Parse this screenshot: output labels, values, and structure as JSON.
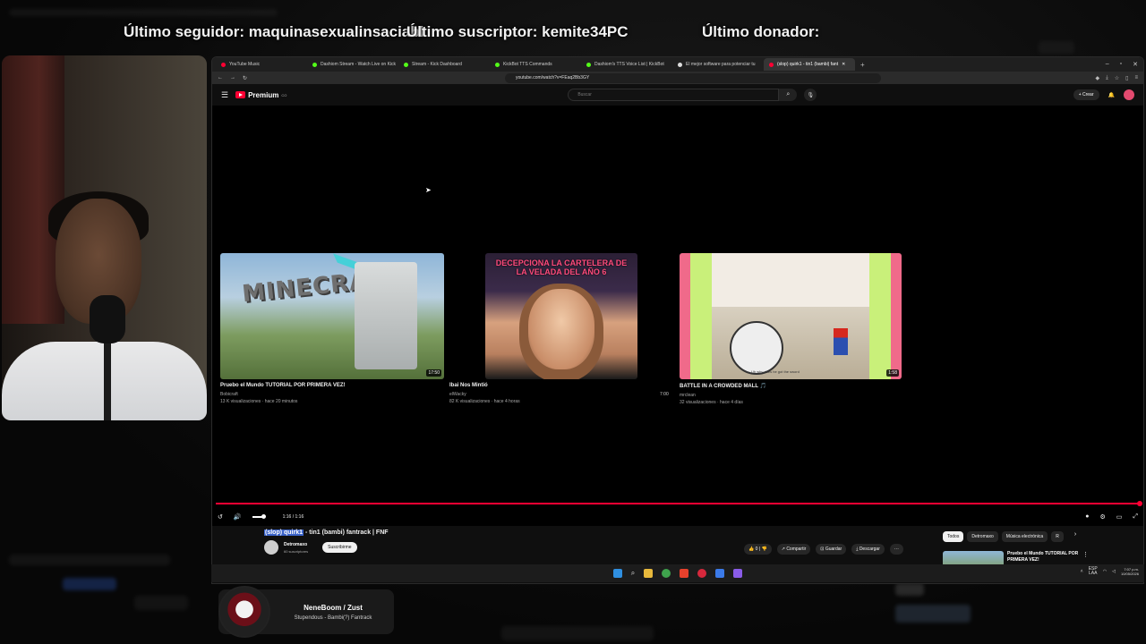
{
  "overlay": {
    "follower": "Último seguidor: maquinasexualinsaciabl",
    "subscriber": "Último suscriptor: kemite34PC",
    "donor": "Último donador:"
  },
  "browser": {
    "tabs": [
      {
        "label": "YouTube Music",
        "color": "#ff0033"
      },
      {
        "label": "Dashiom Stream - Watch Live on Kick",
        "color": "#53fc18"
      },
      {
        "label": "Stream - Kick Dashboard",
        "color": "#53fc18"
      },
      {
        "label": "KickBot TTS Commands",
        "color": "#53fc18"
      },
      {
        "label": "Dashiom's TTS Voice List | KickBot",
        "color": "#53fc18"
      },
      {
        "label": "El mejor software para potenciar tu",
        "color": "#dddddd"
      },
      {
        "label": "(slop) quirk1 - tin1 (bambi) fant",
        "color": "#ff0033"
      }
    ],
    "url": "youtube.com/watch?v=FEaq2Bb3GY"
  },
  "youtube": {
    "logo": "Premium",
    "logo_sup": "CO",
    "search_placeholder": "Buscar",
    "create_label": "Crear",
    "endcards": [
      {
        "title": "Pruebo el Mundo TUTORIAL POR PRIMERA VEZ!",
        "channel": "Bobicraft",
        "meta": "13 K visualizaciones · hace 20 minutos",
        "duration": "17:50",
        "thumb_text": "MINECRAFT"
      },
      {
        "title": "Ibai Nos Mintió",
        "channel": "elWacky",
        "meta": "82 K visualizaciones · hace 4 horas",
        "duration": "7:00",
        "thumb_text": "DECEPCIONA LA CARTELERA DE LA VELADA DEL AÑO 6"
      },
      {
        "title": "BATTLE IN A CROWDED MALL 🎵",
        "channel": "mrclean",
        "meta": "32 visualizaciones · hace 4 días",
        "duration": "1:58",
        "thumb_text": "Uh why does he got the sword"
      }
    ],
    "time": "1:16 / 1:16",
    "progress": 1.0,
    "video_title_highlight": "(slop) quirk1",
    "video_title_rest": " - tin1 (bambi) fantrack | FNF",
    "channel_name": "Detromaxo",
    "channel_subs": "60 suscriptores",
    "subscribe_label": "Suscribirme",
    "likes": "0",
    "share_label": "Compartir",
    "save_label": "Guardar",
    "download_label": "Descargar",
    "chips": [
      "Todos",
      "Detromaxo",
      "Música electrónica",
      "R"
    ],
    "rec_title": "Pruebo el Mundo TUTORIAL POR PRIMERA VEZ!"
  },
  "taskbar": {
    "lang": "ESP",
    "lang2": "LAA",
    "clock_time": "7:07 p.m.",
    "clock_date": "10/05/2026"
  },
  "nowplaying": {
    "title": "NeneBoom / Zust",
    "subtitle": "Stupendous - Bambi(?) Fantrack"
  }
}
